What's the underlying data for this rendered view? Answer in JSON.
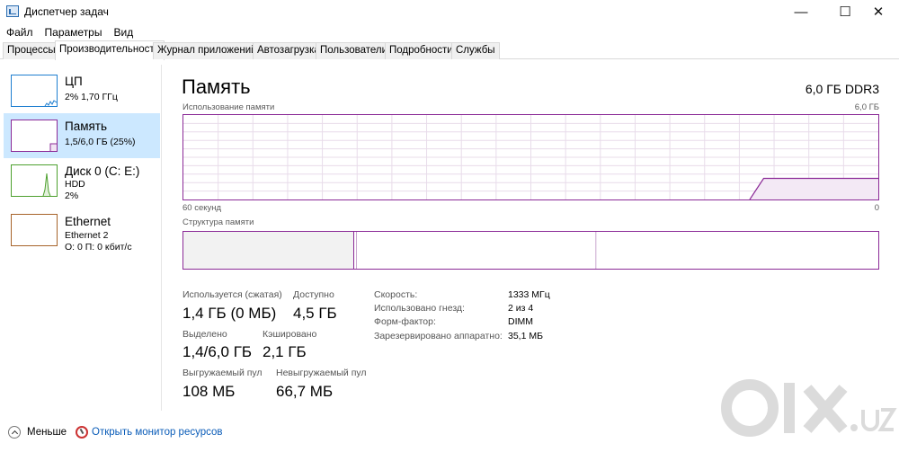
{
  "window": {
    "title": "Диспетчер задач",
    "minimize_glyph": "—",
    "maximize_glyph": "☐",
    "close_glyph": "✕"
  },
  "menu": [
    "Файл",
    "Параметры",
    "Вид"
  ],
  "tabs": [
    {
      "label": "Процессы",
      "active": false
    },
    {
      "label": "Производительность",
      "active": true
    },
    {
      "label": "Журнал приложений",
      "active": false
    },
    {
      "label": "Автозагрузка",
      "active": false
    },
    {
      "label": "Пользователи",
      "active": false
    },
    {
      "label": "Подробности",
      "active": false
    },
    {
      "label": "Службы",
      "active": false
    }
  ],
  "sidebar": {
    "items": [
      {
        "title": "ЦП",
        "line1": "2% 1,70 ГГц",
        "line2": "",
        "color": "#1f7fd0",
        "selected": false
      },
      {
        "title": "Память",
        "line1": "1,5/6,0 ГБ (25%)",
        "line2": "",
        "color": "#8b2a97",
        "selected": true
      },
      {
        "title": "Диск 0 (C: E:)",
        "line1": "HDD",
        "line2": "2%",
        "color": "#4da02e",
        "selected": false
      },
      {
        "title": "Ethernet",
        "line1": "Ethernet 2",
        "line2": "О: 0 П: 0 кбит/с",
        "color": "#a7632a",
        "selected": false
      }
    ]
  },
  "main": {
    "title": "Память",
    "spec": "6,0 ГБ DDR3",
    "usage_label": "Использование памяти",
    "usage_max": "6,0 ГБ",
    "time_left": "60 секунд",
    "time_right": "0",
    "structure_label": "Структура памяти",
    "usage_fraction": 0.25,
    "accent": "#8b2a97"
  },
  "stats": {
    "in_use_label": "Используется (сжатая)",
    "in_use_value": "1,4 ГБ (0 МБ)",
    "available_label": "Доступно",
    "available_value": "4,5 ГБ",
    "committed_label": "Выделено",
    "committed_value": "1,4/6,0 ГБ",
    "cached_label": "Кэшировано",
    "cached_value": "2,1 ГБ",
    "paged_label": "Выгружаемый пул",
    "paged_value": "108 МБ",
    "nonpaged_label": "Невыгружаемый пул",
    "nonpaged_value": "66,7 МБ"
  },
  "details": [
    {
      "label": "Скорость:",
      "value": "1333 МГц"
    },
    {
      "label": "Использовано гнезд:",
      "value": "2 из 4"
    },
    {
      "label": "Форм-фактор:",
      "value": "DIMM"
    },
    {
      "label": "Зарезервировано аппаратно:",
      "value": "35,1 МБ"
    }
  ],
  "footer": {
    "less_label": "Меньше",
    "monitor_link": "Открыть монитор ресурсов"
  }
}
